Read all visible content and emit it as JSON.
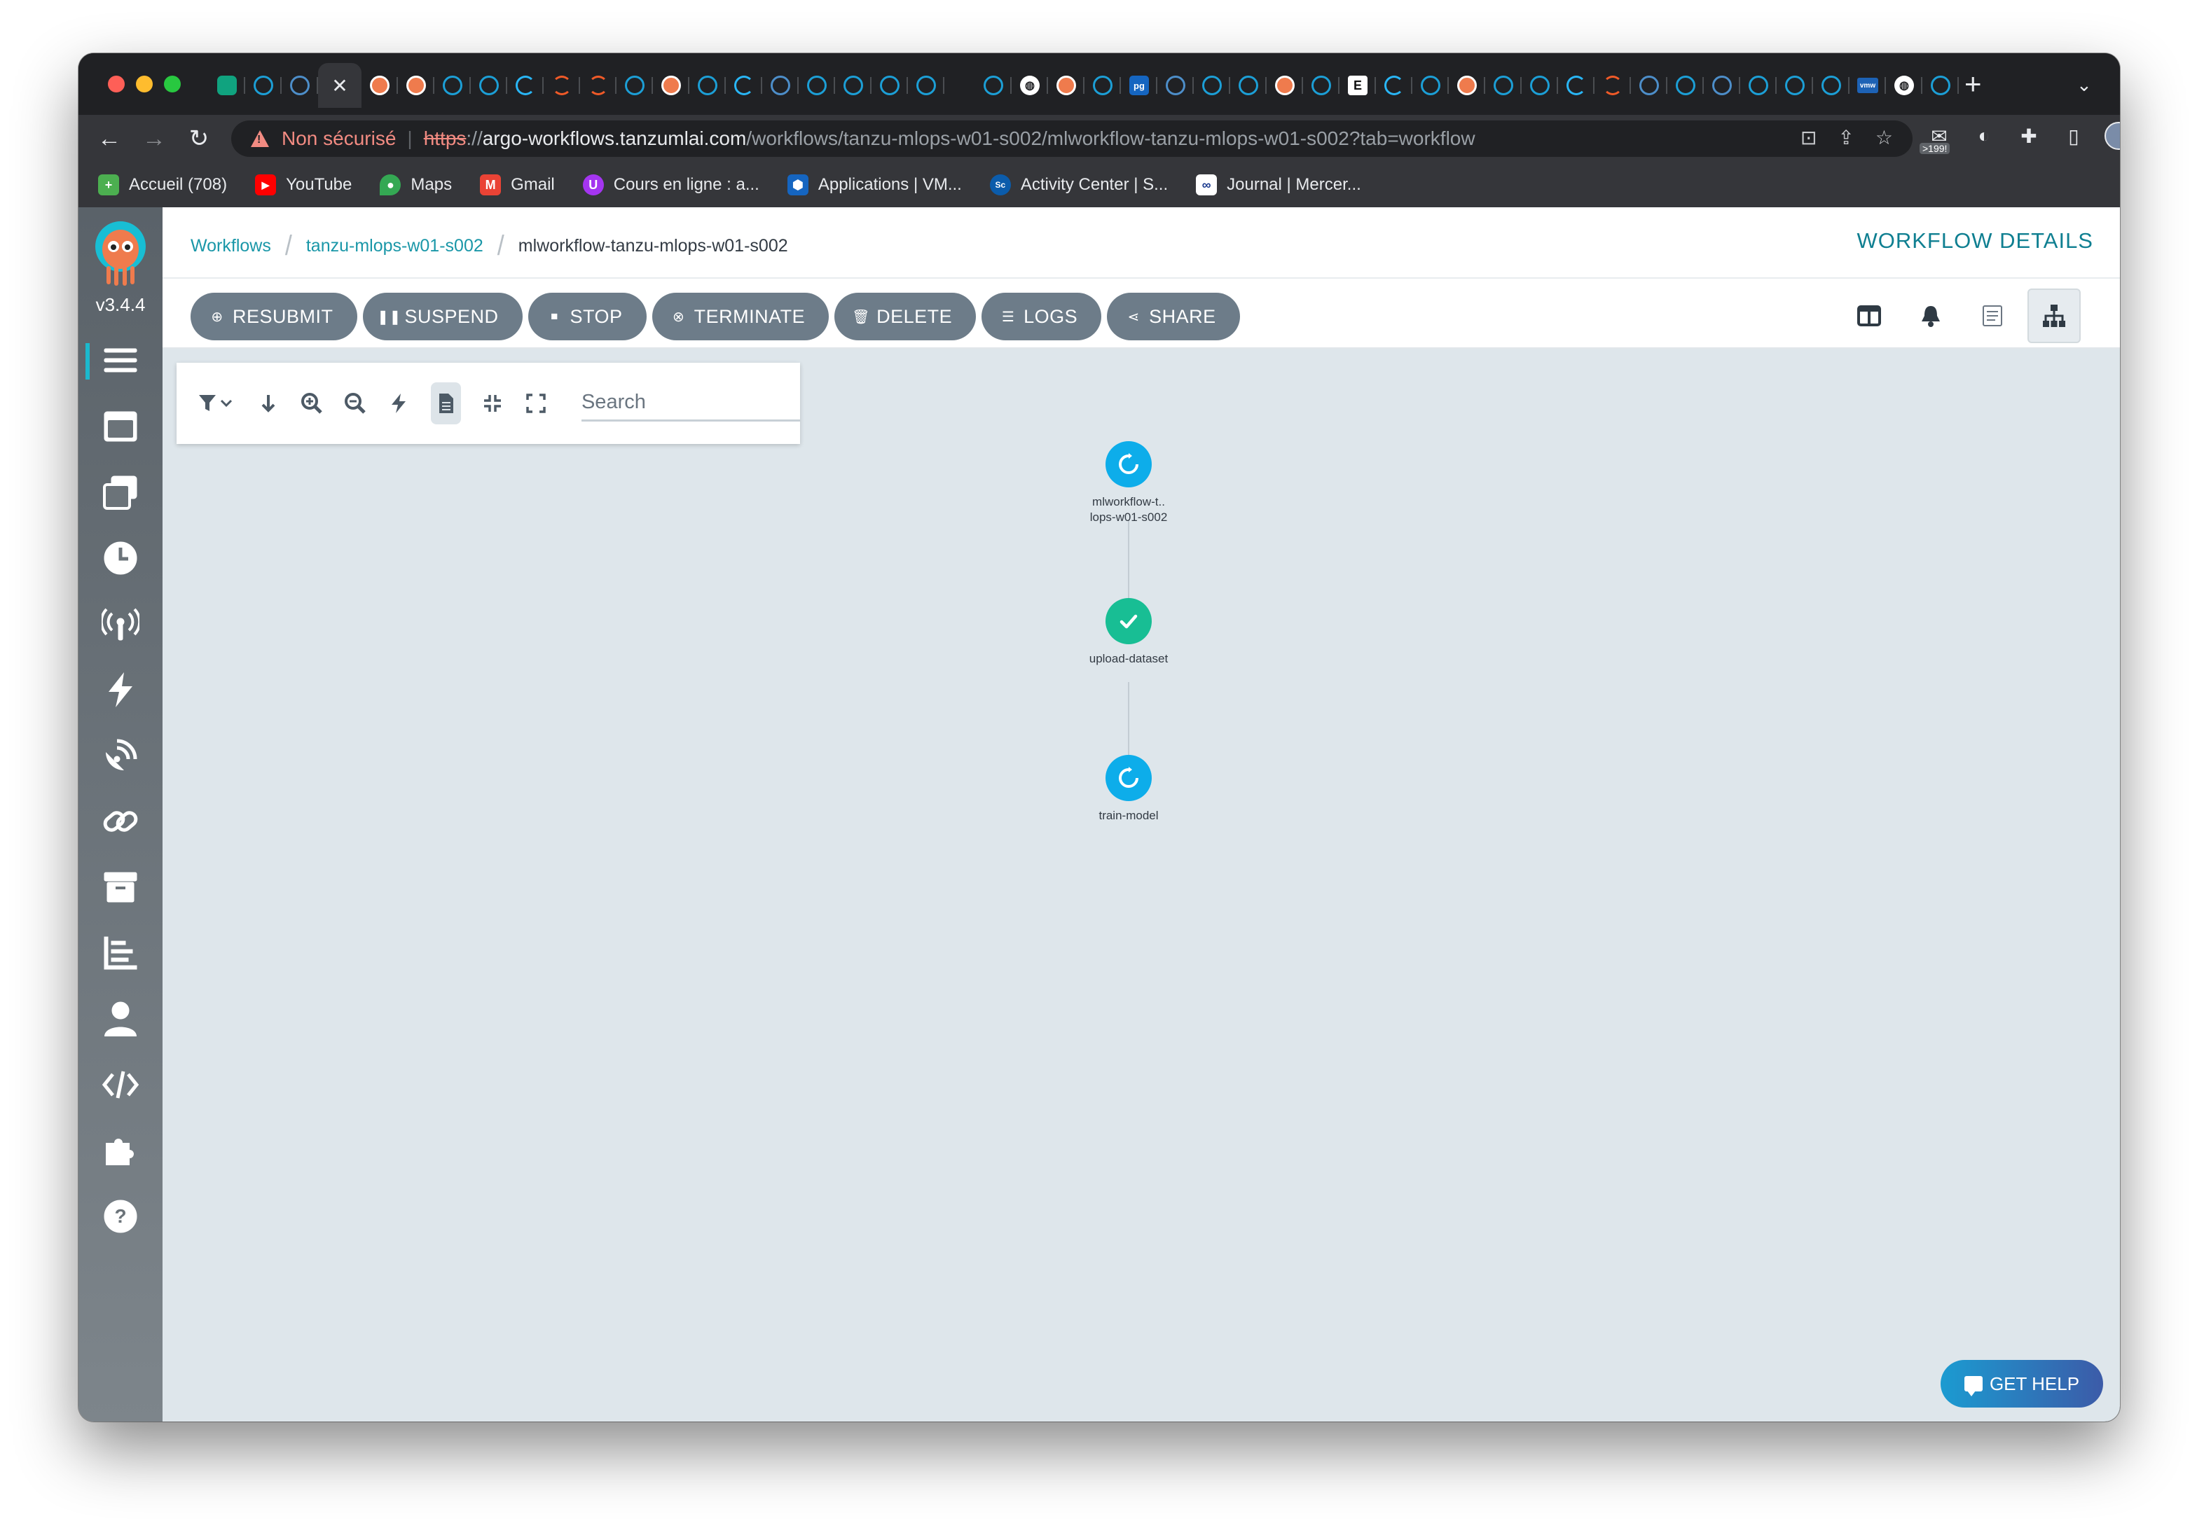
{
  "browser": {
    "url": {
      "not_secure": "Non sécurisé",
      "scheme": "https",
      "separator": "://",
      "host": "argo-workflows.tanzumlai.com",
      "path": "/workflows/tanzu-mlops-w01-s002/mlworkflow-tanzu-mlops-w01-s002?tab=workflow"
    },
    "extension_badge": ">199!",
    "bookmarks": [
      {
        "label": "Accueil (708)",
        "icon": "plus-green-icon",
        "color": "#4caf50"
      },
      {
        "label": "YouTube",
        "icon": "youtube-icon",
        "color": "#ff0000"
      },
      {
        "label": "Maps",
        "icon": "maps-icon",
        "color": "#34a853"
      },
      {
        "label": "Gmail",
        "icon": "gmail-icon",
        "color": "#ea4335"
      },
      {
        "label": "Cours en ligne  : a...",
        "icon": "udemy-icon",
        "color": "#a435f0"
      },
      {
        "label": "Applications | VM...",
        "icon": "vmware-hex-icon",
        "color": "#1565c0"
      },
      {
        "label": "Activity Center | S...",
        "icon": "salesforce-icon",
        "color": "#0b5cab"
      },
      {
        "label": "Journal | Mercer...",
        "icon": "mercer-icon",
        "color": "#1a3a8f"
      }
    ]
  },
  "app": {
    "version": "v3.4.4",
    "breadcrumbs": [
      {
        "label": "Workflows"
      },
      {
        "label": "tanzu-mlops-w01-s002"
      }
    ],
    "breadcrumb_current": "mlworkflow-tanzu-mlops-w01-s002",
    "page_title": "WORKFLOW DETAILS",
    "actions": [
      {
        "label": "RESUBMIT",
        "icon": "plus-circle-icon"
      },
      {
        "label": "SUSPEND",
        "icon": "pause-icon"
      },
      {
        "label": "STOP",
        "icon": "stop-circle-icon"
      },
      {
        "label": "TERMINATE",
        "icon": "x-circle-icon"
      },
      {
        "label": "DELETE",
        "icon": "trash-icon"
      },
      {
        "label": "LOGS",
        "icon": "bars-icon"
      },
      {
        "label": "SHARE",
        "icon": "share-icon"
      }
    ],
    "search_placeholder": "Search",
    "nodes": [
      {
        "label_line1": "mlworkflow-t..",
        "label_line2": "lops-w01-s002",
        "status": "running"
      },
      {
        "label_line1": "upload-dataset",
        "label_line2": "",
        "status": "succeeded"
      },
      {
        "label_line1": "train-model",
        "label_line2": "",
        "status": "running"
      }
    ],
    "get_help": "GET HELP",
    "colors": {
      "accent": "#1a97a8",
      "running": "#0dadea",
      "succeeded": "#18be94",
      "button": "#6d7c89",
      "canvas": "#dee6eb"
    }
  }
}
